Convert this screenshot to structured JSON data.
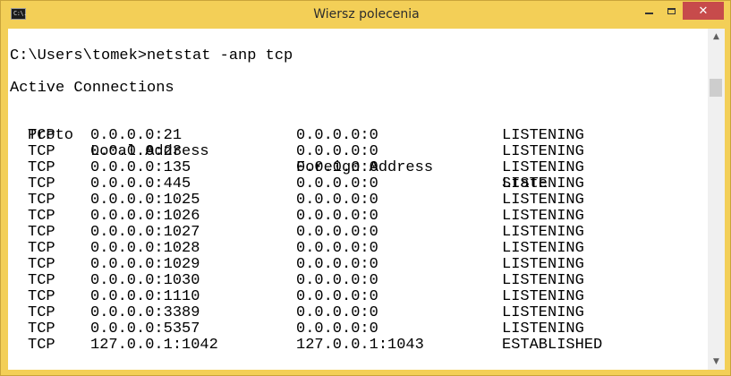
{
  "window": {
    "title": "Wiersz polecenia",
    "icon_text": "C:\\.",
    "controls": [
      "minimize-icon",
      "maximize-icon",
      "close-icon"
    ],
    "close_symbol": "✕"
  },
  "console": {
    "command_line": "C:\\Users\\tomek>netstat -anp tcp",
    "section_title": "Active Connections",
    "headers": {
      "proto": "Proto",
      "local": "Local Address",
      "foreign": "Foreign Address",
      "state": "State"
    },
    "rows": [
      {
        "proto": "TCP",
        "local": "0.0.0.0:21",
        "foreign": "0.0.0.0:0",
        "state": "LISTENING"
      },
      {
        "proto": "TCP",
        "local": "0.0.0.0:23",
        "foreign": "0.0.0.0:0",
        "state": "LISTENING"
      },
      {
        "proto": "TCP",
        "local": "0.0.0.0:135",
        "foreign": "0.0.0.0:0",
        "state": "LISTENING"
      },
      {
        "proto": "TCP",
        "local": "0.0.0.0:445",
        "foreign": "0.0.0.0:0",
        "state": "LISTENING"
      },
      {
        "proto": "TCP",
        "local": "0.0.0.0:1025",
        "foreign": "0.0.0.0:0",
        "state": "LISTENING"
      },
      {
        "proto": "TCP",
        "local": "0.0.0.0:1026",
        "foreign": "0.0.0.0:0",
        "state": "LISTENING"
      },
      {
        "proto": "TCP",
        "local": "0.0.0.0:1027",
        "foreign": "0.0.0.0:0",
        "state": "LISTENING"
      },
      {
        "proto": "TCP",
        "local": "0.0.0.0:1028",
        "foreign": "0.0.0.0:0",
        "state": "LISTENING"
      },
      {
        "proto": "TCP",
        "local": "0.0.0.0:1029",
        "foreign": "0.0.0.0:0",
        "state": "LISTENING"
      },
      {
        "proto": "TCP",
        "local": "0.0.0.0:1030",
        "foreign": "0.0.0.0:0",
        "state": "LISTENING"
      },
      {
        "proto": "TCP",
        "local": "0.0.0.0:1110",
        "foreign": "0.0.0.0:0",
        "state": "LISTENING"
      },
      {
        "proto": "TCP",
        "local": "0.0.0.0:3389",
        "foreign": "0.0.0.0:0",
        "state": "LISTENING"
      },
      {
        "proto": "TCP",
        "local": "0.0.0.0:5357",
        "foreign": "0.0.0.0:0",
        "state": "LISTENING"
      },
      {
        "proto": "TCP",
        "local": "127.0.0.1:1042",
        "foreign": "127.0.0.1:1043",
        "state": "ESTABLISHED"
      }
    ]
  },
  "scrollbar": {
    "up_arrow": "▲",
    "down_arrow": "▼"
  },
  "colors": {
    "frame": "#f3cf57",
    "close_button": "#c74b4b",
    "console_bg": "#ffffff",
    "console_text": "#000000"
  }
}
